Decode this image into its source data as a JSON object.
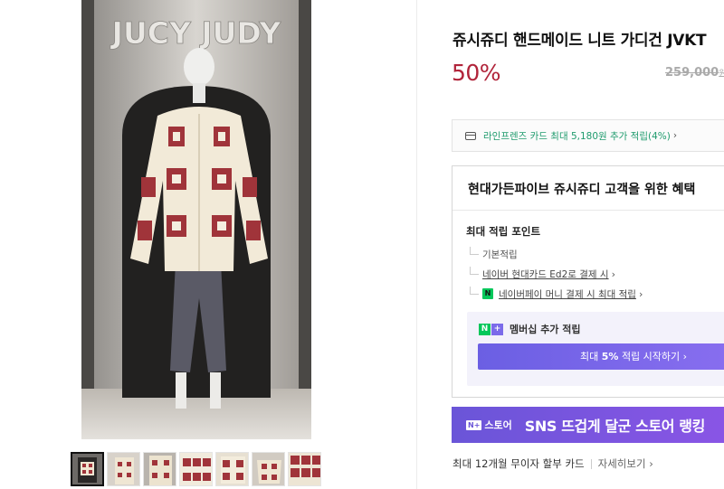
{
  "product": {
    "title": "쥬시쥬디 핸드메이드 니트 가디건 JVKT",
    "discount_rate": "50%",
    "original_price": "259,000",
    "currency_unit": "원"
  },
  "card_promo": {
    "icon": "credit-card-icon",
    "text": "라인프렌즈 카드 최대 5,180원 추가 적립(4%)",
    "chevron": "›"
  },
  "benefit": {
    "heading": "현대가든파이브 쥬시쥬디 고객을 위한 혜택",
    "subheading": "최대 적립 포인트",
    "items": [
      {
        "label": "기본적립",
        "link": false,
        "chevron": ""
      },
      {
        "label": "네이버 현대카드 Ed2로 결제 시",
        "link": true,
        "chevron": "›"
      },
      {
        "label": "네이버페이 머니 결제 시 최대 적립",
        "link": true,
        "chevron": "›",
        "badge": "N"
      }
    ],
    "membership": {
      "badge_n": "N",
      "badge_plus": "+",
      "label": "멤버십 추가 적립",
      "button_prefix": "최대",
      "button_rate": "5%",
      "button_suffix": "적립 시작하기",
      "button_chevron": "›"
    }
  },
  "banner": {
    "logo_n": "N+",
    "logo_text": "스토어",
    "text": "SNS 뜨겁게 달군 스토어 랭킹"
  },
  "installment": {
    "text": "최대 12개월 무이자 할부 카드",
    "detail": "자세히보기",
    "chevron": "›"
  },
  "gallery": {
    "storefront_sign": "JUCY JUDY",
    "thumbnail_count": 7,
    "active_thumbnail": 1
  },
  "colors": {
    "discount": "#b1243a",
    "point_green": "#1f9b6d",
    "naver_green": "#03c75a",
    "membership_purple": "#6b5fe3",
    "banner_purple": "#6a55d8"
  }
}
